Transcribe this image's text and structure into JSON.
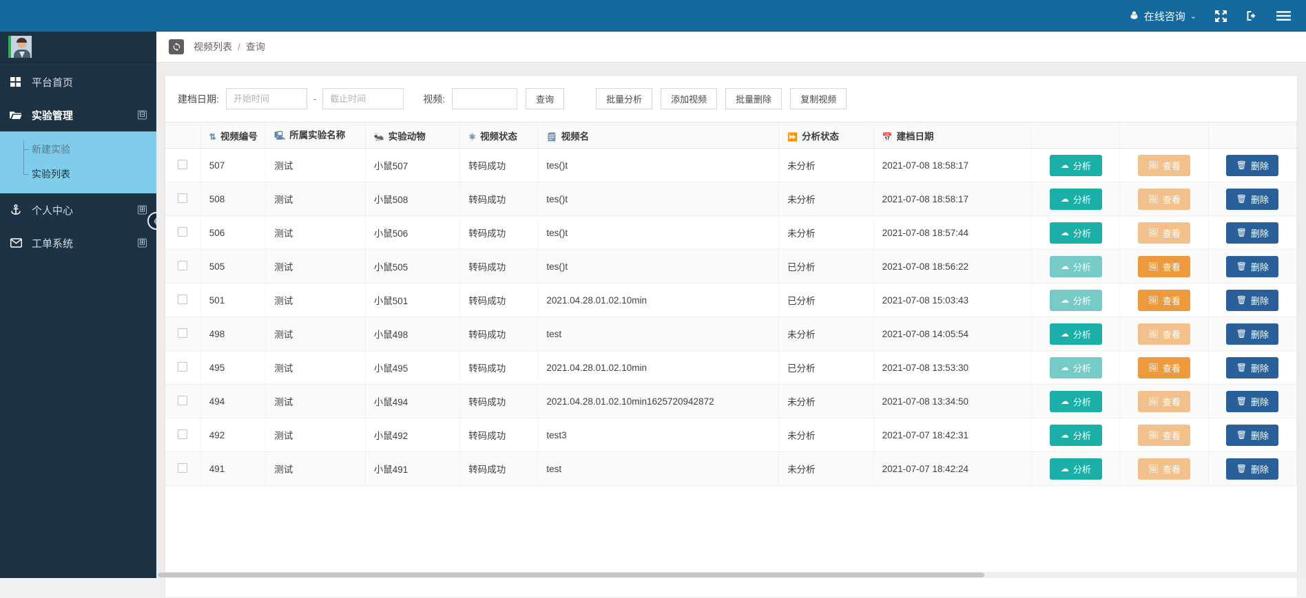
{
  "topbar": {
    "consult_label": "在线咨询",
    "consult_icon": "bell-icon",
    "caret": "⌄",
    "fullscreen_icon": "✥",
    "logout_icon": "➜",
    "menu_icon": "☰"
  },
  "sidebar": {
    "avatar_name": "user-avatar",
    "items": [
      {
        "label": "平台首页",
        "icon": "grid-icon",
        "toggle": ""
      },
      {
        "label": "实验管理",
        "icon": "folder-open-icon",
        "toggle": "⊟"
      },
      {
        "label": "个人中心",
        "icon": "anchor-icon",
        "toggle": "⊞"
      },
      {
        "label": "工单系统",
        "icon": "envelope-icon",
        "toggle": "⊞"
      }
    ],
    "submenu": [
      {
        "label": "新建实验",
        "state": "dim"
      },
      {
        "label": "实验列表",
        "state": "cur"
      }
    ],
    "collapse_icon": "❮"
  },
  "breadcrumb": {
    "icon": "refresh-icon",
    "root": "视频列表",
    "sep": "/",
    "current": "查询"
  },
  "filter": {
    "date_label": "建档日期:",
    "start_placeholder": "开始时间",
    "start_value": "",
    "dash": "-",
    "end_placeholder": "截止时间",
    "end_value": "",
    "video_label": "视频:",
    "video_placeholder": "",
    "video_value": "",
    "search_label": "查询",
    "buttons": [
      "批量分析",
      "添加视频",
      "批量删除",
      "复制视频"
    ]
  },
  "table": {
    "headers": [
      {
        "label": "",
        "icon": ""
      },
      {
        "label": "视频编号",
        "icon": "⇅"
      },
      {
        "label": "所属实验名称",
        "icon": "🖳"
      },
      {
        "label": "实验动物",
        "icon": "🐜"
      },
      {
        "label": "视频状态",
        "icon": "⚛"
      },
      {
        "label": "视频名",
        "icon": "🗒"
      },
      {
        "label": "分析状态",
        "icon": "⏩"
      },
      {
        "label": "建档日期",
        "icon": "📅"
      },
      {
        "label": "",
        "icon": ""
      },
      {
        "label": "",
        "icon": ""
      },
      {
        "label": "",
        "icon": ""
      }
    ],
    "actions": {
      "analyze": "分析",
      "analyze_icon": "☁",
      "view": "查看",
      "view_icon": "🖼",
      "delete": "删除",
      "delete_icon": "🗑"
    },
    "rows": [
      {
        "id": "507",
        "experiment": "测试",
        "animal": "小鼠507",
        "video_state": "转码成功",
        "video_name": "tes()t",
        "analysis_state": "未分析",
        "created": "2021-07-08 18:58:17",
        "analyzed": false
      },
      {
        "id": "508",
        "experiment": "测试",
        "animal": "小鼠508",
        "video_state": "转码成功",
        "video_name": "tes()t",
        "analysis_state": "未分析",
        "created": "2021-07-08 18:58:17",
        "analyzed": false
      },
      {
        "id": "506",
        "experiment": "测试",
        "animal": "小鼠506",
        "video_state": "转码成功",
        "video_name": "tes()t",
        "analysis_state": "未分析",
        "created": "2021-07-08 18:57:44",
        "analyzed": false
      },
      {
        "id": "505",
        "experiment": "测试",
        "animal": "小鼠505",
        "video_state": "转码成功",
        "video_name": "tes()t",
        "analysis_state": "已分析",
        "created": "2021-07-08 18:56:22",
        "analyzed": true
      },
      {
        "id": "501",
        "experiment": "测试",
        "animal": "小鼠501",
        "video_state": "转码成功",
        "video_name": "2021.04.28.01.02.10min",
        "analysis_state": "已分析",
        "created": "2021-07-08 15:03:43",
        "analyzed": true
      },
      {
        "id": "498",
        "experiment": "测试",
        "animal": "小鼠498",
        "video_state": "转码成功",
        "video_name": "test",
        "analysis_state": "未分析",
        "created": "2021-07-08 14:05:54",
        "analyzed": false
      },
      {
        "id": "495",
        "experiment": "测试",
        "animal": "小鼠495",
        "video_state": "转码成功",
        "video_name": "2021.04.28.01.02.10min",
        "analysis_state": "已分析",
        "created": "2021-07-08 13:53:30",
        "analyzed": true
      },
      {
        "id": "494",
        "experiment": "测试",
        "animal": "小鼠494",
        "video_state": "转码成功",
        "video_name": "2021.04.28.01.02.10min1625720942872",
        "analysis_state": "未分析",
        "created": "2021-07-08 13:34:50",
        "analyzed": false
      },
      {
        "id": "492",
        "experiment": "测试",
        "animal": "小鼠492",
        "video_state": "转码成功",
        "video_name": "test3",
        "analysis_state": "未分析",
        "created": "2021-07-07 18:42:31",
        "analyzed": false
      },
      {
        "id": "491",
        "experiment": "测试",
        "animal": "小鼠491",
        "video_state": "转码成功",
        "video_name": "test",
        "analysis_state": "未分析",
        "created": "2021-07-07 18:42:24",
        "analyzed": false
      }
    ]
  },
  "colors": {
    "topbar": "#14699e",
    "sidebar": "#1d3245",
    "submenu_active": "#7fcdea",
    "analyze": "#1ab0a8",
    "view": "#ee9a3c",
    "delete": "#2a6099"
  }
}
